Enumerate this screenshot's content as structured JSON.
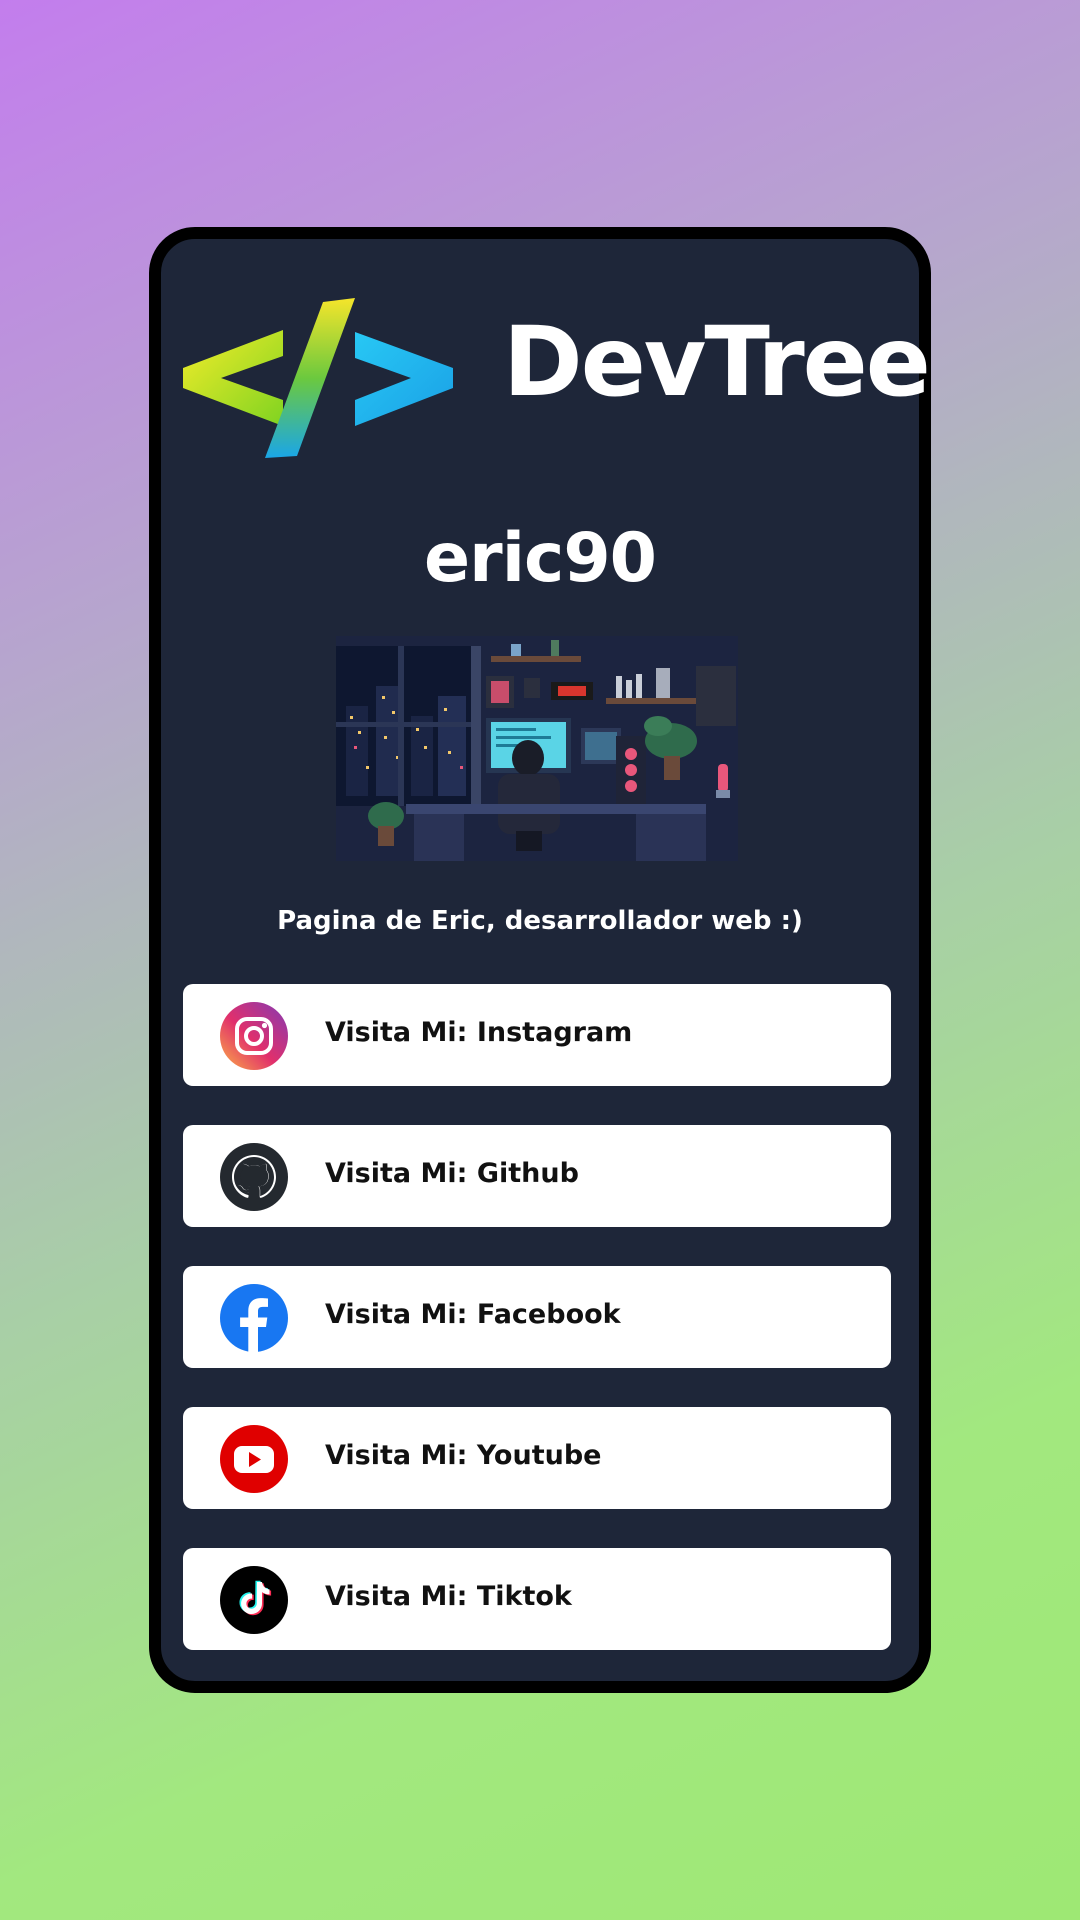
{
  "brand": {
    "name": "DevTree",
    "icon": "code-brackets-icon"
  },
  "profile": {
    "username": "eric90",
    "bio": "Pagina de Eric, desarrollador web :)",
    "avatar_icon": "pixel-art-room-image"
  },
  "links": [
    {
      "label": "Visita Mi: Instagram",
      "icon": "instagram-icon"
    },
    {
      "label": "Visita Mi: Github",
      "icon": "github-icon"
    },
    {
      "label": "Visita Mi: Facebook",
      "icon": "facebook-icon"
    },
    {
      "label": "Visita Mi: Youtube",
      "icon": "youtube-icon"
    },
    {
      "label": "Visita Mi: Tiktok",
      "icon": "tiktok-icon"
    }
  ],
  "colors": {
    "card_background": "#1e2639",
    "card_border": "#000000",
    "link_background": "#ffffff",
    "gradient_start": "#c37ded",
    "gradient_end": "#9ee874"
  }
}
